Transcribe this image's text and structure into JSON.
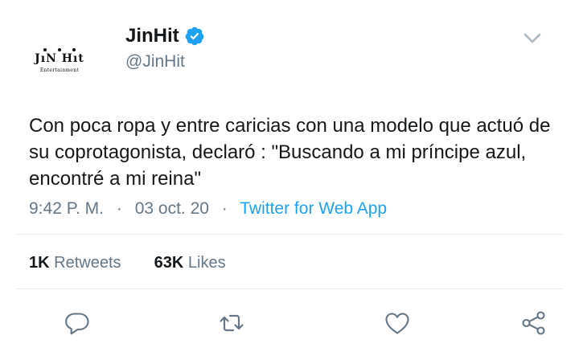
{
  "header": {
    "display_name": "JinHit",
    "handle": "@JinHit",
    "avatar_logo": "JıN Hıt",
    "avatar_subtitle": "Entertainment",
    "verified_icon": "verified-badge-icon",
    "menu_icon": "chevron-down-icon"
  },
  "tweet": {
    "text": "Con poca ropa y entre caricias con una modelo que actuó de su coprotagonista, declaró : \"Buscando a mi príncipe azul, encontré a mi reina\""
  },
  "meta": {
    "time": "9:42 P. M.",
    "separator": "·",
    "date": "03 oct. 20",
    "source": "Twitter for Web App"
  },
  "stats": {
    "retweets_count": "1K",
    "retweets_label": "Retweets",
    "likes_count": "63K",
    "likes_label": "Likes"
  },
  "actions": [
    "reply-icon",
    "retweet-icon",
    "like-icon",
    "share-icon"
  ],
  "colors": {
    "accent": "#1da1f2",
    "text": "#14171a",
    "secondary": "#657786",
    "divider": "#e6ecf0"
  }
}
